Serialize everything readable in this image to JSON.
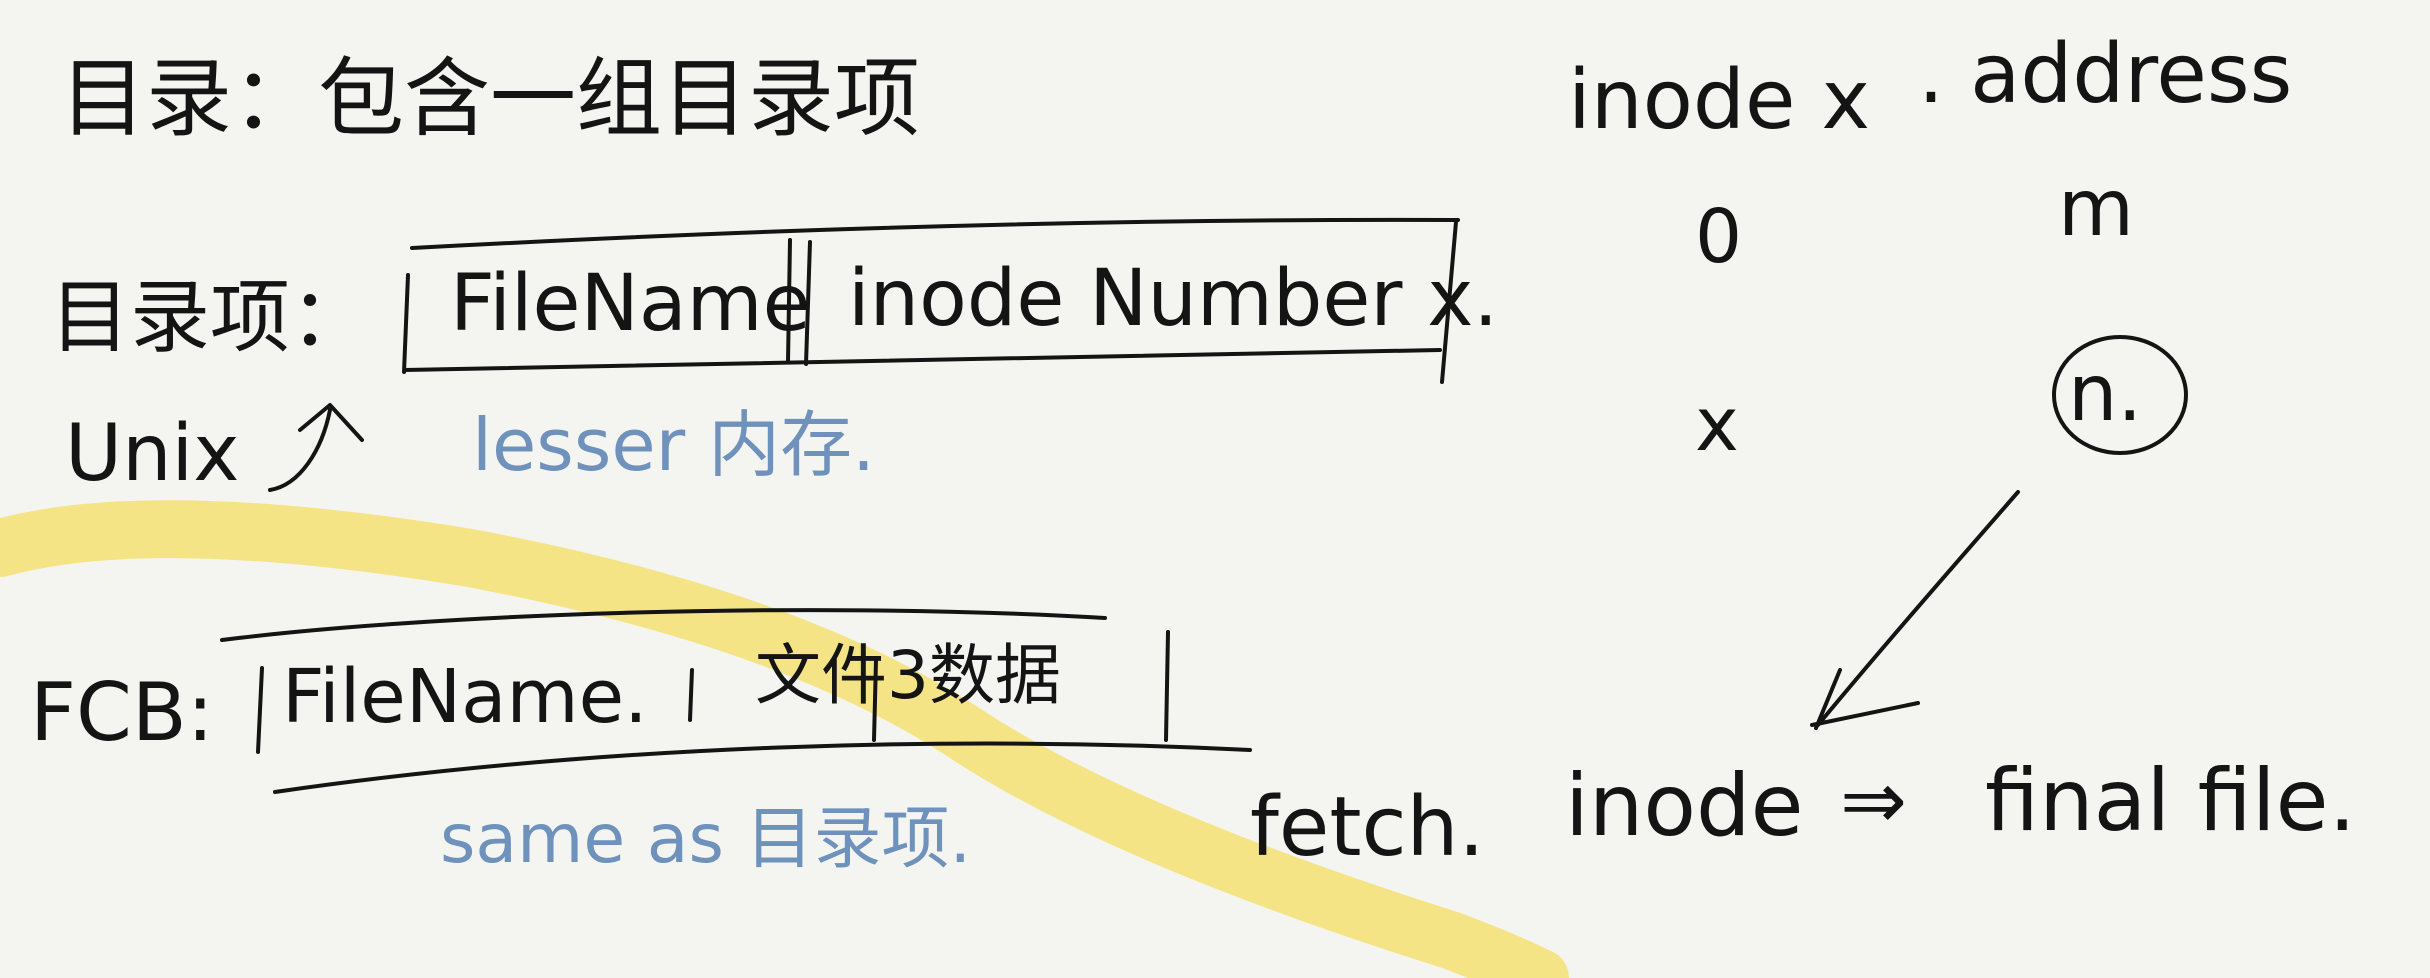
{
  "note": {
    "directory_definition": "目录：包含一组目录项",
    "entry_label": "目录项：",
    "entry_fields": [
      "FileName",
      "inode Number x."
    ],
    "unix_label": "Unix",
    "unix_benefit": "lesser 内存.",
    "fcb_label": "FCB:",
    "fcb_fields": [
      "FileName.",
      "文件3数据"
    ],
    "fcb_note": "same as 目录项.",
    "fetch_label": "fetch.",
    "flow": {
      "source": "inode",
      "arrow": "⇒",
      "target": "final file."
    }
  },
  "inode_table": {
    "headers": [
      "inode x",
      ". address"
    ],
    "rows": [
      {
        "inode": "0",
        "address": "m"
      },
      {
        "inode": "x",
        "address": "n."
      }
    ],
    "highlighted_address": "n."
  },
  "colors": {
    "ink": "#141414",
    "blue_annotation": "#6f92bd",
    "highlighter": "#f5e27a",
    "background": "#f4f5f0"
  }
}
